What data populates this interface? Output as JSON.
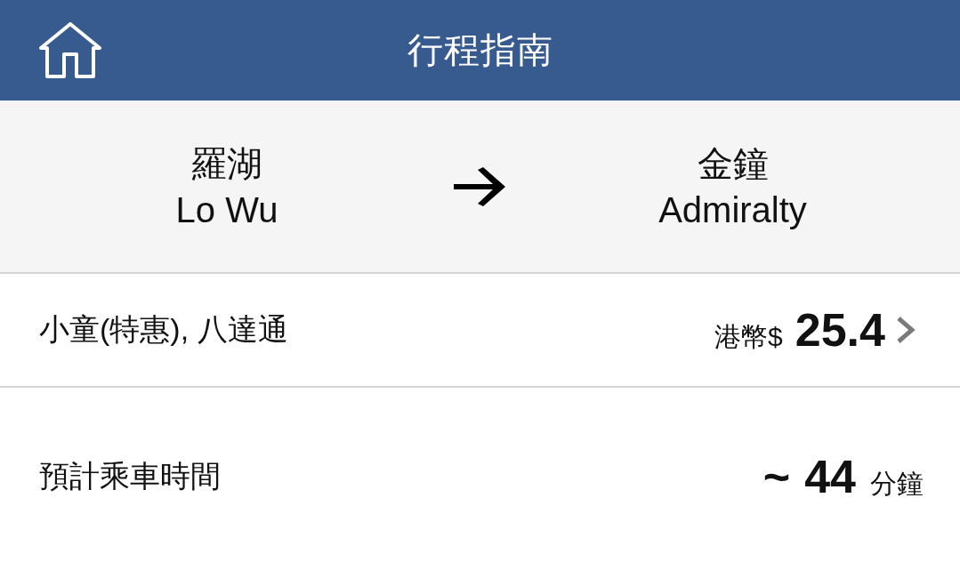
{
  "header": {
    "title": "行程指南"
  },
  "route": {
    "from": {
      "name_zh": "羅湖",
      "name_en": "Lo Wu"
    },
    "to": {
      "name_zh": "金鐘",
      "name_en": "Admiralty"
    }
  },
  "fare": {
    "label": "小童(特惠), 八達通",
    "currency": "港幣$",
    "amount": "25.4"
  },
  "journey_time": {
    "label": "預計乘車時間",
    "prefix": "~",
    "value": "44",
    "unit": "分鐘"
  }
}
